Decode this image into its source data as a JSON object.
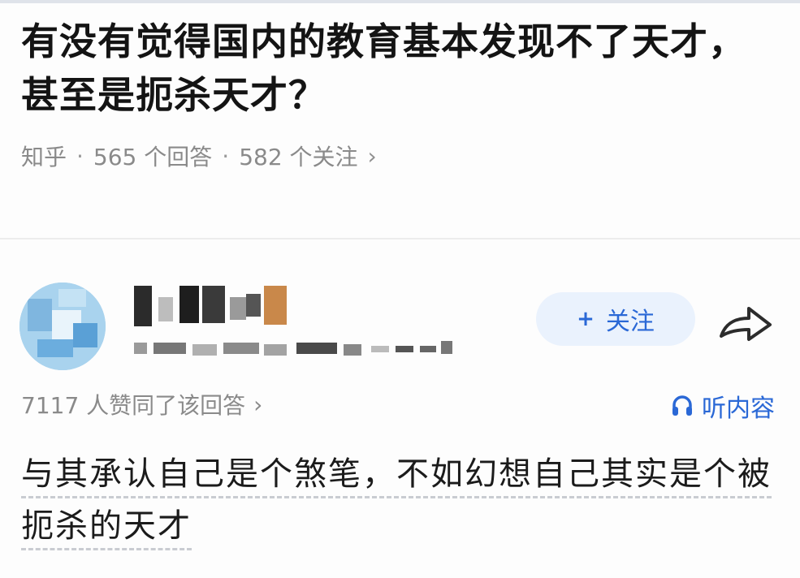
{
  "question": {
    "title": "有没有觉得国内的教育基本发现不了天才，甚至是扼杀天才？",
    "source": "知乎",
    "answers_count": "565 个回答",
    "followers_count": "582 个关注",
    "separator": "·",
    "chevron": "›"
  },
  "author": {
    "follow_plus": "+",
    "follow_label": "关注",
    "share_icon": "share-icon",
    "avatar_color": "#9ccbe9"
  },
  "stats": {
    "likes": "7117 人赞同了该回答",
    "chevron": "›",
    "listen_label": "听内容",
    "listen_icon": "headphones-icon"
  },
  "answer": {
    "body": "与其承认自己是个煞笔，不如幻想自己其实是个被扼杀的天才"
  },
  "colors": {
    "accent": "#2a68d6",
    "follow_bg": "#eaf2fd",
    "meta_text": "#8a8a8a",
    "title_text": "#141414"
  }
}
